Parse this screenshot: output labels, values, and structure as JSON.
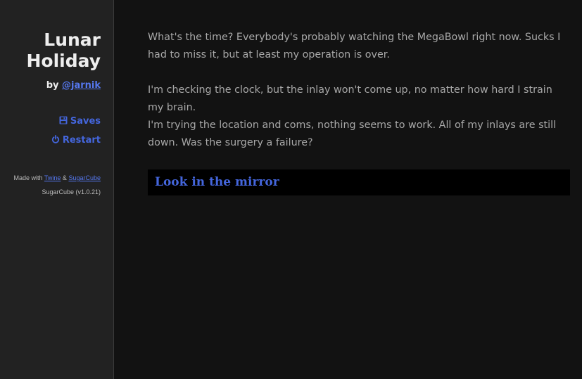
{
  "sidebar": {
    "title_line1": "Lunar",
    "title_line2": "Holiday",
    "author_prefix": "by",
    "author_handle": "@jarnik",
    "menu": {
      "saves_label": "Saves",
      "restart_label": "Restart",
      "saves_icon": "floppy-disk-icon",
      "restart_icon": "power-icon"
    },
    "credits": {
      "made_with": "Made with",
      "twine": "Twine",
      "amp": "&",
      "sugarcube": "SugarCube",
      "version": "SugarCube (v1.0.21)"
    }
  },
  "passage": {
    "para1": "What's the time? Everybody's probably watching the MegaBowl right now. Sucks I had to miss it, but at least my operation is over.",
    "para2": "I'm checking the clock, but the inlay won't come up, no matter how hard I strain my brain.",
    "para3": "I'm trying the location and coms, nothing seems to work. All of my inlays are still down. Was the surgery a failure?"
  },
  "choice": {
    "label": "Look in the mirror"
  },
  "colors": {
    "background": "#121212",
    "sidebar_bg": "#222222",
    "link": "#4466dd",
    "text": "#a8a8a8"
  }
}
